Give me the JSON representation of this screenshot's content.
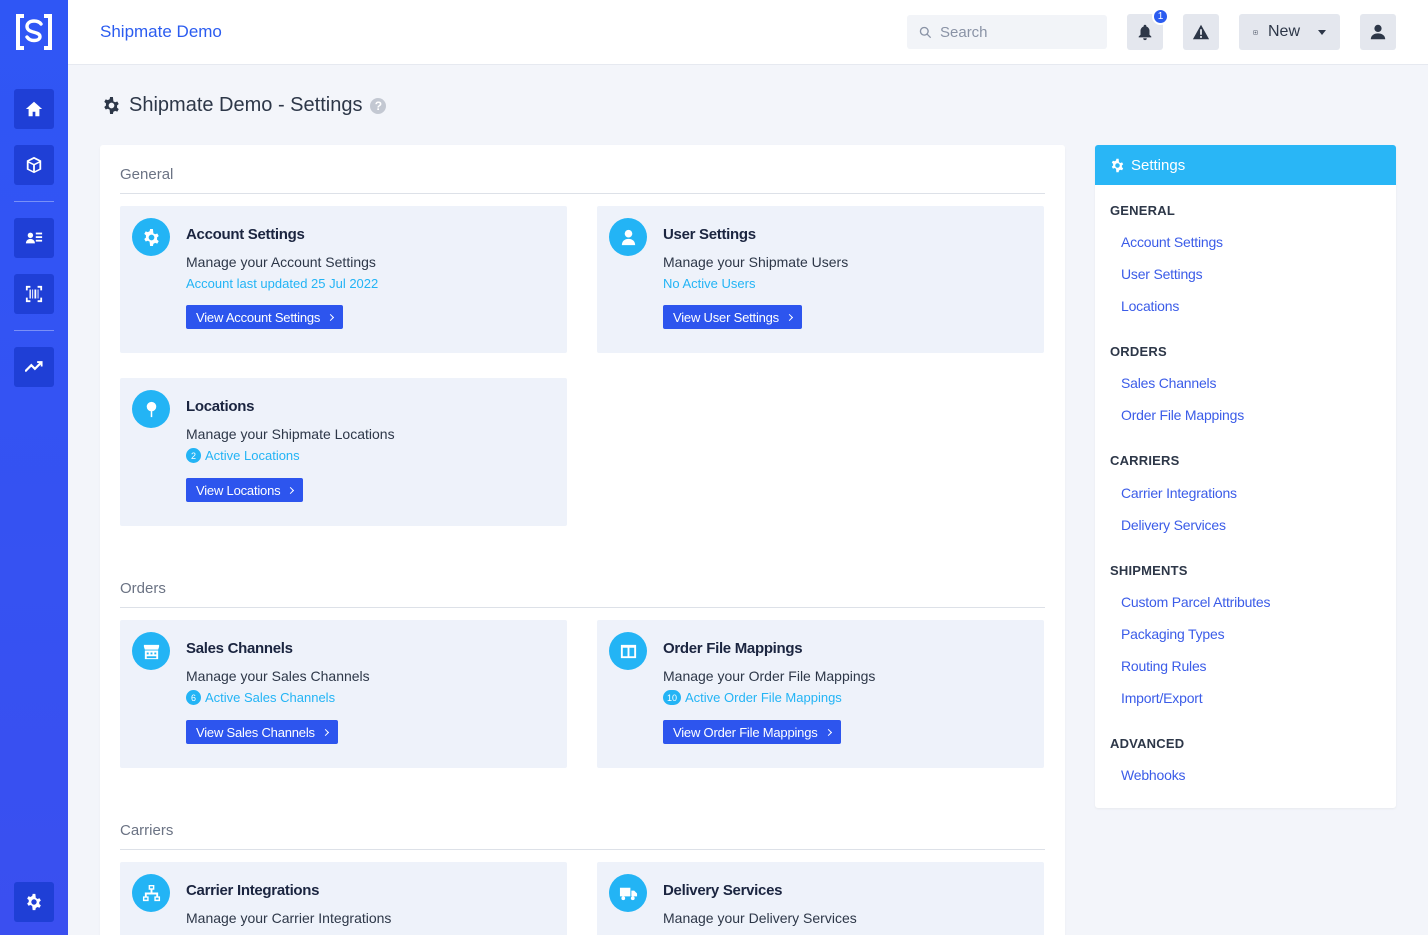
{
  "app": {
    "brand": "Shipmate Demo"
  },
  "topbar": {
    "search_placeholder": "Search",
    "notification_count": "1",
    "new_label": "New"
  },
  "page": {
    "title": "Shipmate Demo - Settings",
    "help": "?"
  },
  "sections": {
    "general": "General",
    "orders": "Orders",
    "carriers": "Carriers"
  },
  "cards": {
    "account": {
      "title": "Account Settings",
      "desc": "Manage your Account Settings",
      "status": "Account last updated 25 Jul 2022",
      "button": "View Account Settings"
    },
    "users": {
      "title": "User Settings",
      "desc": "Manage your Shipmate Users",
      "status": "No Active Users",
      "button": "View User Settings"
    },
    "locations": {
      "title": "Locations",
      "desc": "Manage your Shipmate Locations",
      "count": "2",
      "status": "Active Locations",
      "button": "View Locations"
    },
    "sales_channels": {
      "title": "Sales Channels",
      "desc": "Manage your Sales Channels",
      "count": "6",
      "status": "Active Sales Channels",
      "button": "View Sales Channels"
    },
    "order_file_mappings": {
      "title": "Order File Mappings",
      "desc": "Manage your Order File Mappings",
      "count": "10",
      "status": "Active Order File Mappings",
      "button": "View Order File Mappings"
    },
    "carrier_integrations": {
      "title": "Carrier Integrations",
      "desc": "Manage your Carrier Integrations"
    },
    "delivery_services": {
      "title": "Delivery Services",
      "desc": "Manage your Delivery Services"
    }
  },
  "side_panel": {
    "title": "Settings",
    "groups": {
      "general": "GENERAL",
      "orders": "ORDERS",
      "carriers": "CARRIERS",
      "shipments": "SHIPMENTS",
      "advanced": "ADVANCED"
    },
    "links": {
      "account_settings": "Account Settings",
      "user_settings": "User Settings",
      "locations": "Locations",
      "sales_channels": "Sales Channels",
      "order_file_mappings": "Order File Mappings",
      "carrier_integrations": "Carrier Integrations",
      "delivery_services": "Delivery Services",
      "custom_parcel_attributes": "Custom Parcel Attributes",
      "packaging_types": "Packaging Types",
      "routing_rules": "Routing Rules",
      "import_export": "Import/Export",
      "webhooks": "Webhooks"
    }
  },
  "colors": {
    "sidebar": "#2f56f5",
    "accent": "#2b5cf0",
    "info": "#23b4f5",
    "button": "#2d55ee"
  },
  "icons": {
    "logo": "shipmate-logo",
    "nav": [
      "home-icon",
      "package-icon",
      "contacts-icon",
      "barcode-icon",
      "chart-line-icon",
      "gear-icon"
    ]
  }
}
